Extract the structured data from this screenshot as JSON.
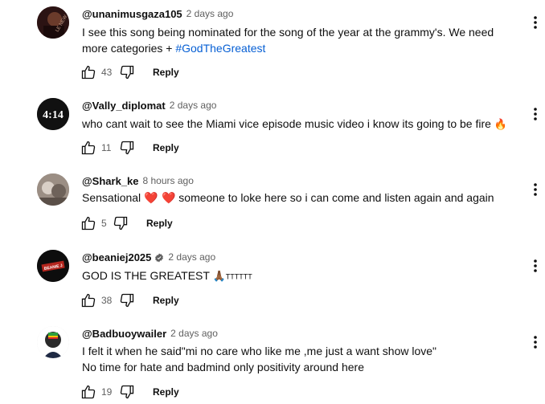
{
  "comments": [
    {
      "author": "@unanimusgaza105",
      "time": "2 days ago",
      "line1": "I see this song being nominated for the song of the year at the grammy's. We need",
      "line2_prefix": "more categories + ",
      "hashtag": "#GodTheGreatest",
      "likes": "43",
      "reply": "Reply",
      "avatar_color": "#3a1a1a"
    },
    {
      "author": "@Vally_diplomat",
      "time": "2 days ago",
      "text": "who cant wait to see the Miami vice episode music video i know its going to be fire",
      "emoji": "🔥",
      "likes": "11",
      "reply": "Reply",
      "avatar_text": "4:14",
      "avatar_color": "#111111"
    },
    {
      "author": "@Shark_ke",
      "time": "8 hours ago",
      "text_before": "Sensational",
      "hearts": "❤️ ❤️",
      "text_after": "someone to loke here so i can come and listen again and again",
      "likes": "5",
      "reply": "Reply",
      "avatar_color": "#8a7d74"
    },
    {
      "author": "@beaniej2025",
      "time": "2 days ago",
      "text": "GOD IS THE GREATEST",
      "emoji": "🙏🏾",
      "suffix": "TTTTTT",
      "likes": "38",
      "reply": "Reply",
      "avatar_text": "BEANIE J",
      "avatar_color": "#0d0d0d"
    },
    {
      "author": "@Badbuoywailer",
      "time": "2 days ago",
      "line1": "I felt it when he said\"mi no care who like me ,me just a want show love\"",
      "line2": "No time for hate and badmind only positivity around here",
      "likes": "19",
      "reply": "Reply",
      "avatar_color": "#d9d9d9"
    }
  ],
  "colors": {
    "link": "#065fd4",
    "secondary_text": "#606060",
    "heart": "#e0262b"
  },
  "icons": [
    "thumbs-up-icon",
    "thumbs-down-icon",
    "more-vert-icon",
    "verified-icon"
  ]
}
